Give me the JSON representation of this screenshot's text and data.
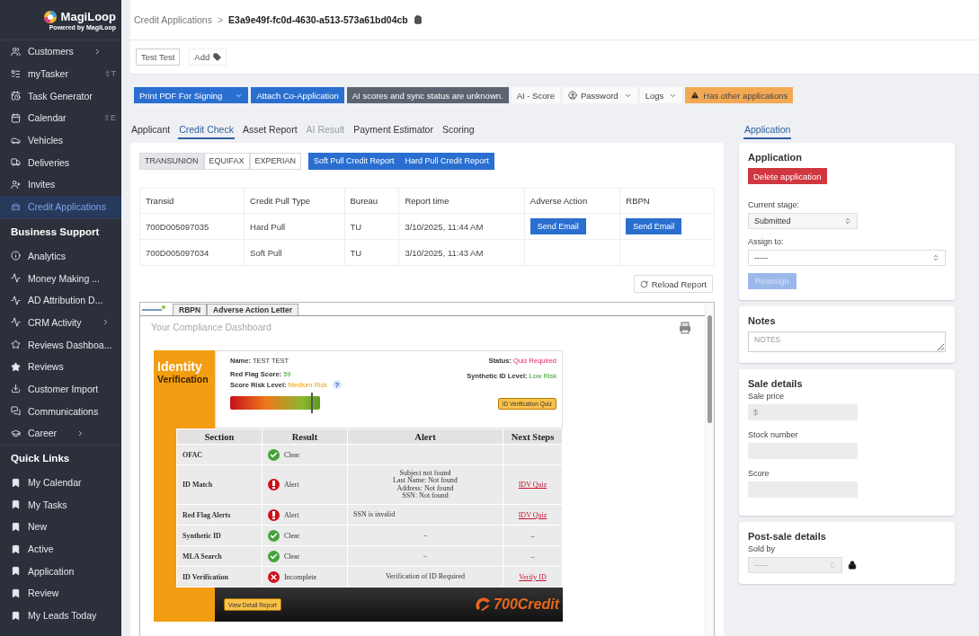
{
  "sidebar": {
    "logo": {
      "name": "MagiLoop",
      "tagline": "Powered by MagiLoop"
    },
    "items": [
      {
        "label": "Customers",
        "selected": false,
        "submenu": true
      },
      {
        "label": "myTasker",
        "selected": false,
        "submenu": false,
        "shortcut": "⇧T"
      },
      {
        "label": "Task Generator",
        "selected": false,
        "submenu": false
      },
      {
        "label": "Calendar",
        "selected": false,
        "submenu": false,
        "shortcut": "⇧E"
      },
      {
        "label": "Vehicles",
        "selected": false,
        "submenu": false
      },
      {
        "label": "Deliveries",
        "selected": false,
        "submenu": false
      },
      {
        "label": "Invites",
        "selected": false,
        "submenu": false
      },
      {
        "label": "Credit Applications",
        "selected": true,
        "submenu": false
      }
    ],
    "sections": [
      {
        "title": "Business Support",
        "items": [
          {
            "label": "Analytics",
            "selected": false,
            "submenu": false
          },
          {
            "label": "Money Making ...",
            "selected": false,
            "submenu": false
          },
          {
            "label": "AD Attribution D...",
            "selected": false,
            "submenu": false
          },
          {
            "label": "CRM Activity",
            "selected": false,
            "submenu": true
          },
          {
            "label": "Reviews Dashboa...",
            "selected": false,
            "submenu": false
          },
          {
            "label": "Reviews",
            "selected": false,
            "submenu": false
          },
          {
            "label": "Customer Import",
            "selected": false,
            "submenu": false
          },
          {
            "label": "Communications",
            "selected": false,
            "submenu": false
          },
          {
            "label": "Career",
            "selected": false,
            "submenu": true
          }
        ]
      },
      {
        "title": "Quick Links",
        "items": [
          {
            "label": "My Calendar",
            "selected": false,
            "submenu": false
          },
          {
            "label": "My Tasks",
            "selected": false,
            "submenu": false
          },
          {
            "label": "New",
            "selected": false,
            "submenu": false
          },
          {
            "label": "Active",
            "selected": false,
            "submenu": false
          },
          {
            "label": "Application",
            "selected": false,
            "submenu": false
          },
          {
            "label": "Review",
            "selected": false,
            "submenu": false
          },
          {
            "label": "My Leads Today",
            "selected": false,
            "submenu": false
          }
        ]
      }
    ]
  },
  "breadcrumb": {
    "parent": "Credit Applications",
    "separator": ">",
    "current": "E3a9e49f-fc0d-4630-a513-573a61bd04cb"
  },
  "tags": {
    "name": "Test Test",
    "add": "Add"
  },
  "actions": [
    {
      "label": "Print PDF For Signing",
      "kind": "split"
    },
    {
      "label": "Attach Co-Application",
      "kind": "primary"
    },
    {
      "label": "AI scores and sync status are unknown.",
      "kind": "info"
    },
    {
      "label": "AI - Score",
      "kind": "plain"
    },
    {
      "label": "Password",
      "kind": "account"
    },
    {
      "label": "Logs",
      "kind": "dropdown"
    },
    {
      "label": "Has other applications",
      "kind": "warning"
    }
  ],
  "tabs": [
    {
      "label": "Applicant",
      "selected": false,
      "disabled": false
    },
    {
      "label": "Credit Check",
      "selected": true,
      "disabled": false
    },
    {
      "label": "Asset Report",
      "selected": false,
      "disabled": false
    },
    {
      "label": "AI Result",
      "selected": false,
      "disabled": true
    },
    {
      "label": "Payment Estimator",
      "selected": false,
      "disabled": false
    },
    {
      "label": "Scoring",
      "selected": false,
      "disabled": false
    }
  ],
  "bureaus": [
    {
      "label": "TRANSUNION",
      "selected": true
    },
    {
      "label": "EQUIFAX",
      "selected": false
    },
    {
      "label": "EXPERIAN",
      "selected": false
    }
  ],
  "pull_buttons": [
    "Soft Pull Credit Report",
    "Hard Pull Credit Report"
  ],
  "credit_table": {
    "columns": [
      "Transid",
      "Credit Pull Type",
      "Bureau",
      "Report time",
      "Adverse Action",
      "RBPN"
    ],
    "rows": [
      {
        "transid": "700D005097035",
        "pull_type": "Hard Pull",
        "bureau": "TU",
        "report_time": "3/10/2025, 11:44 AM",
        "adverse_action": "Send Email",
        "rbpn": "Send Email"
      },
      {
        "transid": "700D005097034",
        "pull_type": "Soft Pull",
        "bureau": "TU",
        "report_time": "3/10/2025, 11:43 AM"
      }
    ]
  },
  "reload_button": "Reload Report",
  "report": {
    "tabs": [
      "RBPN",
      "Adverse Action Letter"
    ],
    "title": "Your Compliance Dashboard",
    "identity": {
      "heading_1": "Identity",
      "heading_2": "Verification",
      "name_label": "Name:",
      "name": "TEST TEST",
      "red_flag_label": "Red Flag Score:",
      "red_flag_score": "59",
      "risk_label": "Score Risk Level:",
      "risk": "Medium Risk",
      "help": "?",
      "status_label": "Status:",
      "status": "Quiz Required",
      "synthetic_label": "Synthetic ID Level:",
      "synthetic": "Low Risk",
      "level": 0.9,
      "quiz_button": "ID Verification Quiz"
    },
    "columns": [
      "Section",
      "Result",
      "Alert",
      "Next Steps"
    ],
    "rows": [
      {
        "section": "OFAC",
        "result": "Clear",
        "kind": "clear"
      },
      {
        "section": "ID Match",
        "result": "Alert",
        "kind": "alert",
        "alert": "Subject not found\nLast Name: Not found\nAddress: Not found\nSSN: Not found",
        "next_step": "IDV Quiz"
      },
      {
        "section": "Red Flag Alerts",
        "result": "Alert",
        "kind": "alert",
        "alert": "SSN is invalid",
        "next_step": "IDV Quiz"
      },
      {
        "section": "Synthetic ID",
        "result": "Clear",
        "kind": "clear",
        "alert": "–",
        "next_step": "–"
      },
      {
        "section": "MLA Search",
        "result": "Clear",
        "kind": "clear",
        "alert": "–",
        "next_step": "–"
      },
      {
        "section": "ID Verification",
        "result": "Incomplete",
        "kind": "incomplete",
        "alert": "Verification of ID Required",
        "next_step": "Verify ID"
      }
    ],
    "detail_button": "View Detail Report",
    "brand": "700Credit"
  },
  "right_tab": {
    "label": "Application",
    "selected": true
  },
  "application": {
    "title": "Application",
    "delete_button": "Delete application",
    "stage_label": "Current stage:",
    "stage": "Submitted",
    "assign_label": "Assign to:",
    "assign": "-----",
    "reassign_button": "Reassign"
  },
  "notes": {
    "title": "Notes",
    "placeholder": "NOTES"
  },
  "sale": {
    "title": "Sale details",
    "fields": [
      {
        "label": "Sale price",
        "placeholder": "$"
      },
      {
        "label": "Stock number"
      },
      {
        "label": "Score"
      }
    ]
  },
  "post_sale": {
    "title": "Post-sale details",
    "sold_by_label": "Sold by",
    "sold_by": "-----",
    "locked": true
  }
}
